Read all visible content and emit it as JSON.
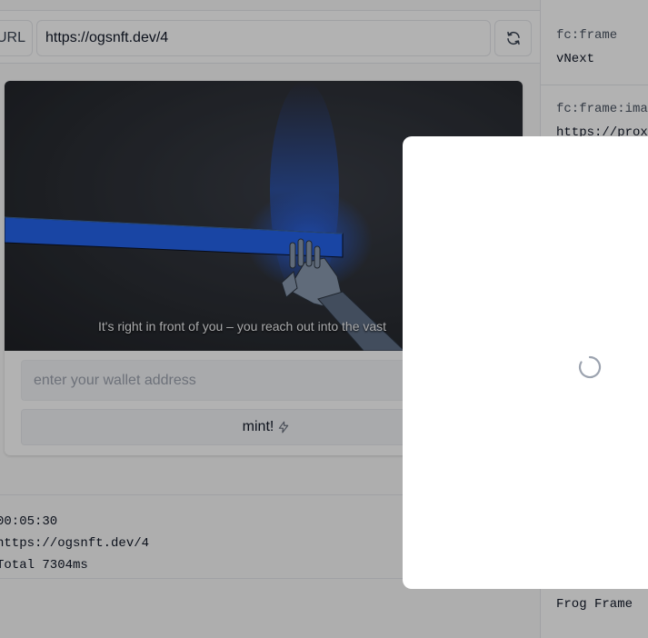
{
  "urlbar": {
    "label": "URL",
    "value": "https://ogsnft.dev/4"
  },
  "frame": {
    "caption": "It's right in front of you – you reach out into the vast",
    "wallet_placeholder": "enter your wallet address",
    "mint_label": "mint!",
    "mint_icon": "lightning-icon"
  },
  "log": {
    "time": "00:05:30",
    "url": "https://ogsnft.dev/4",
    "total": "Total 7304ms"
  },
  "meta": {
    "rows": [
      {
        "key": "fc:frame",
        "value": "vNext"
      },
      {
        "key": "fc:frame:image",
        "value": "https://proxy"
      }
    ],
    "footer": "Frog Frame"
  },
  "colors": {
    "accent_blue": "#1f5fe8",
    "overlay": "rgba(0,0,0,0.30)"
  }
}
